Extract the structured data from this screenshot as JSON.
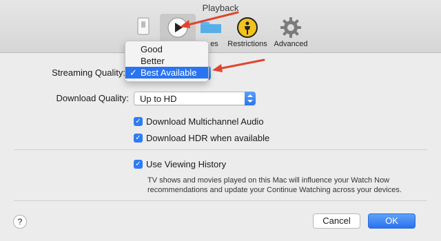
{
  "window": {
    "title": "Playback"
  },
  "toolbar": {
    "items": [
      {
        "label": "",
        "icon": "general-switch-icon"
      },
      {
        "label": "Playback",
        "icon": "play-icon"
      },
      {
        "label": "Files",
        "icon": "folder-icon",
        "visible_label": "es"
      },
      {
        "label": "Restrictions",
        "icon": "restrictions-icon"
      },
      {
        "label": "Advanced",
        "icon": "gear-icon"
      }
    ]
  },
  "streaming": {
    "label": "Streaming Quality:",
    "menu": [
      "Good",
      "Better",
      "Best Available"
    ],
    "checkmark": "✓",
    "selected": "Best Available"
  },
  "download": {
    "label": "Download Quality:",
    "value": "Up to HD"
  },
  "checkboxes": {
    "multichannel": "Download Multichannel Audio",
    "hdr": "Download HDR when available",
    "history": "Use Viewing History"
  },
  "note": "TV shows and movies played on this Mac will influence your Watch Now recommendations and update your Continue Watching across your devices.",
  "buttons": {
    "help": "?",
    "cancel": "Cancel",
    "ok": "OK"
  },
  "colors": {
    "accent": "#2b74ef",
    "annotation": "#e0462e"
  }
}
